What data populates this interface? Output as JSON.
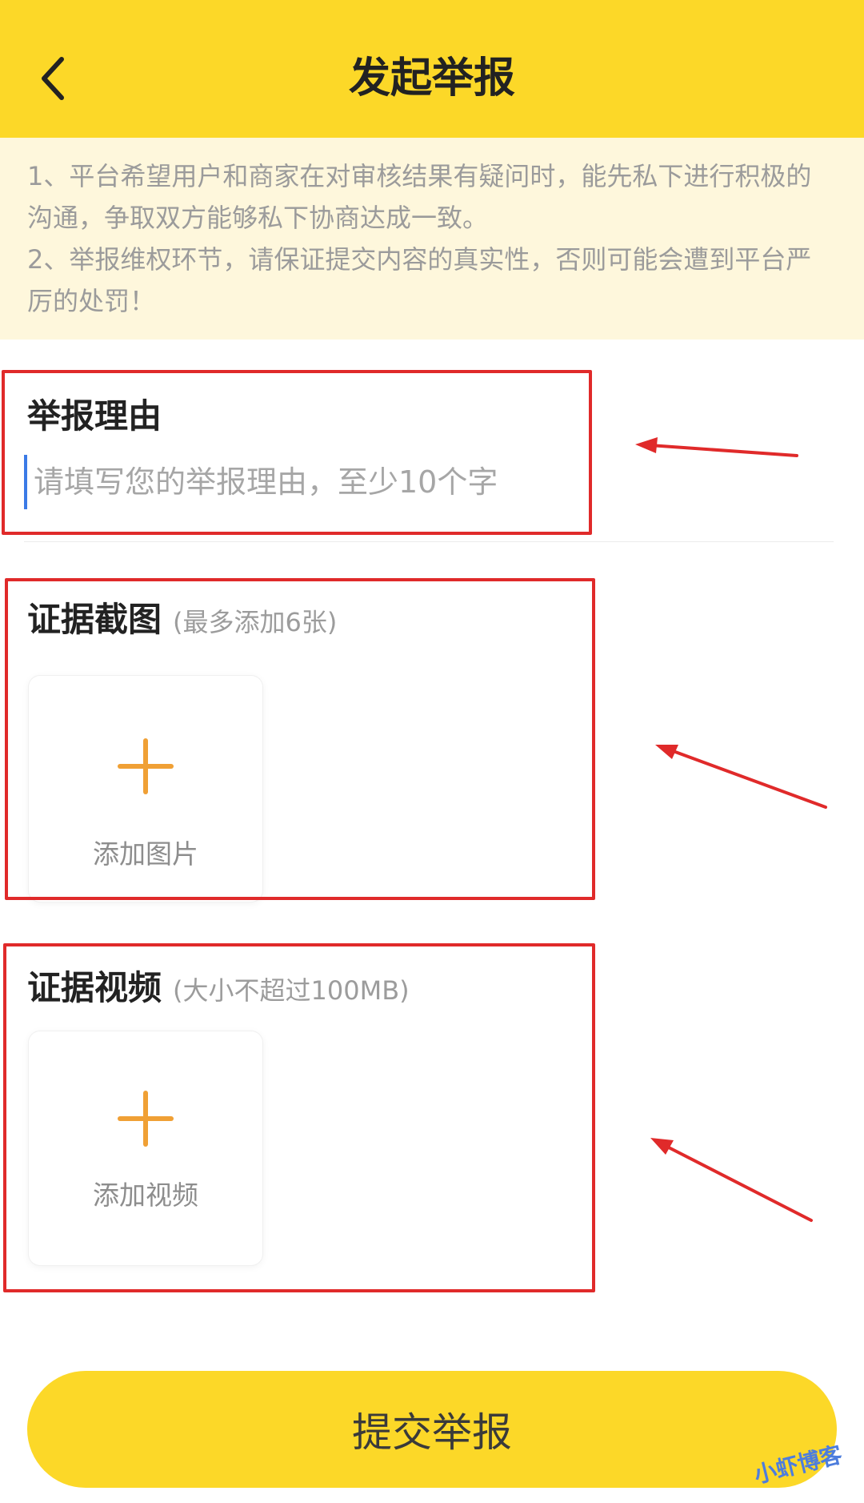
{
  "header": {
    "title": "发起举报",
    "back_icon": "chevron-left-icon"
  },
  "notice": {
    "lines": [
      "1、平台希望用户和商家在对审核结果有疑问时，能先私下进行积极的沟通，争取双方能够私下协商达成一致。",
      "2、举报维权环节，请保证提交内容的真实性，否则可能会遭到平台严厉的处罚！"
    ]
  },
  "reason": {
    "title": "举报理由",
    "placeholder": "请填写您的举报理由，至少10个字",
    "value": ""
  },
  "screenshots": {
    "title": "证据截图",
    "hint": "(最多添加6张)",
    "add_label": "添加图片",
    "icon": "plus-icon"
  },
  "video": {
    "title": "证据视频",
    "hint": "(大小不超过100MB)",
    "add_label": "添加视频",
    "icon": "plus-icon"
  },
  "submit": {
    "label": "提交举报"
  },
  "watermark": "小虾博客",
  "colors": {
    "header_bg": "#fcd828",
    "notice_bg": "#fef7dc",
    "accent_plus": "#f0a035",
    "annotation_red": "#e02a2a"
  }
}
